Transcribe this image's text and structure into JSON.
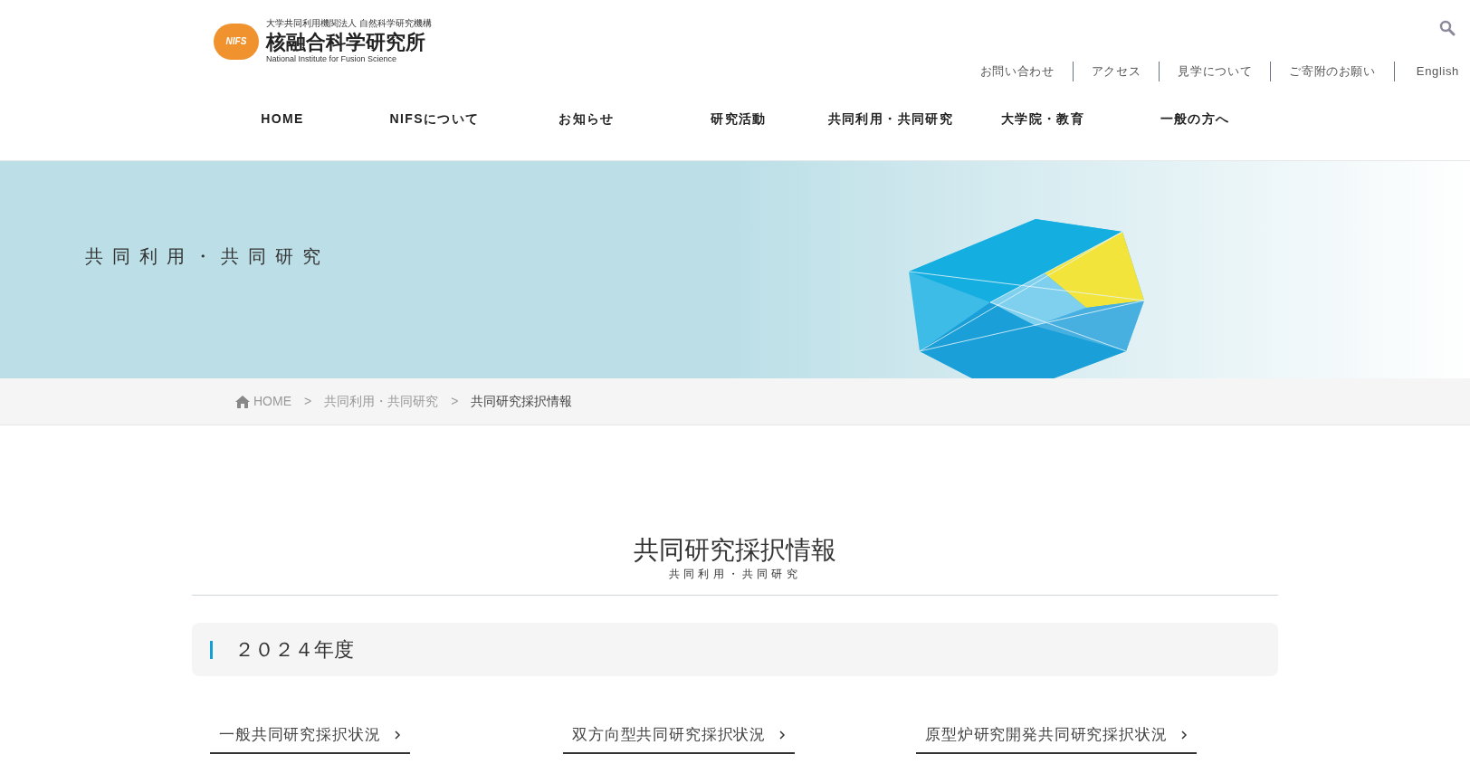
{
  "header": {
    "logo": {
      "org_line": "大学共同利用機関法人 自然科学研究機構",
      "name": "核融合科学研究所",
      "name_en": "National Institute for Fusion Science",
      "mark": "NIFS"
    },
    "utility_links": [
      "お問い合わせ",
      "アクセス",
      "見学について",
      "ご寄附のお願い",
      "English"
    ]
  },
  "nav": [
    "HOME",
    "NIFSについて",
    "お知らせ",
    "研究活動",
    "共同利用・共同研究",
    "大学院・教育",
    "一般の方へ"
  ],
  "hero": {
    "title": "共同利用・共同研究"
  },
  "breadcrumb": [
    {
      "label": "HOME"
    },
    {
      "separator": ">",
      "label": "共同利用・共同研究"
    },
    {
      "separator": ">",
      "label": "共同研究採択情報"
    }
  ],
  "page_heading": {
    "title": "共同研究採択情報",
    "subtitle": "共同利用・共同研究"
  },
  "section": {
    "title": "２０２４年度",
    "links": [
      "一般共同研究採択状況",
      "双方向型共同研究採択状況",
      "原型炉研究開発共同研究採択状況"
    ]
  }
}
